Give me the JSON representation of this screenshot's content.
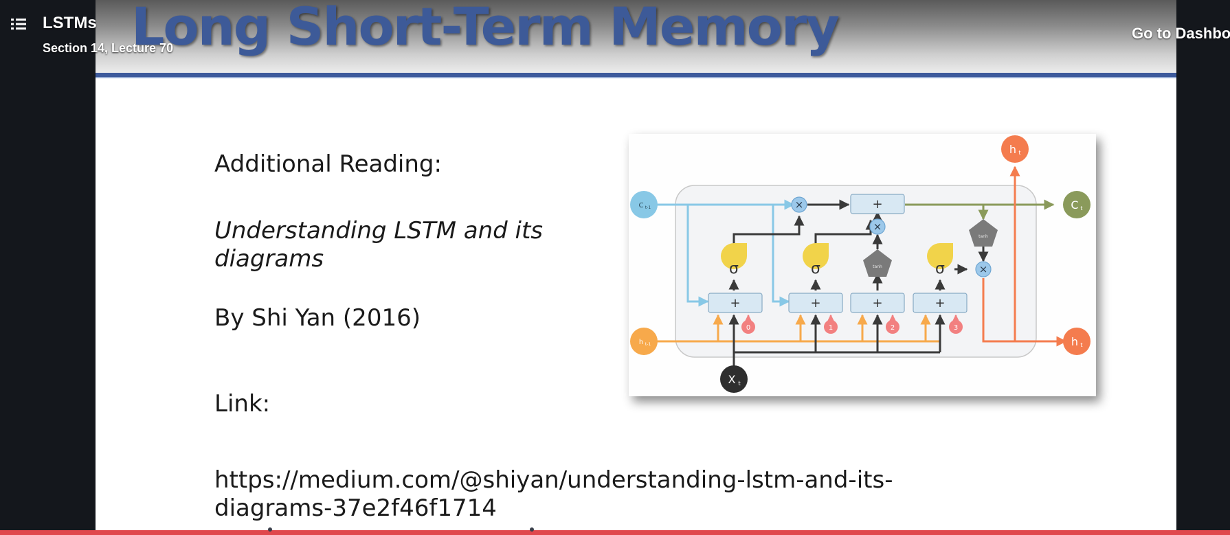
{
  "player": {
    "lecture_title": "LSTMs",
    "lecture_subtitle": "Section 14, Lecture 70",
    "dashboard_button": "Go to Dashbo"
  },
  "slide": {
    "title": "Long Short-Term Memory",
    "reading_heading": "Additional Reading:",
    "article_title_line1": "Understanding LSTM and its",
    "article_title_line2": "diagrams",
    "author": "By Shi Yan (2016)",
    "link_label": "Link:",
    "url_line1": "https://medium.com/@shiyan/understanding-lstm-and-its-",
    "url_line2": "diagrams-37e2f46f1714"
  },
  "diagram": {
    "inputs": {
      "c_prev": "C",
      "c_prev_sub": "t-1",
      "h_prev": "h",
      "h_prev_sub": "t-1",
      "x": "X",
      "x_sub": "t"
    },
    "outputs": {
      "h": "h",
      "h_sub": "t",
      "c": "C",
      "c_sub": "t"
    },
    "sigma": "σ",
    "plus": "+",
    "times": "×",
    "tanh": "tanh",
    "bias_labels": [
      "0",
      "1",
      "2",
      "3"
    ],
    "colors": {
      "cell": "#88c8e6",
      "hidden": "#f7a94b",
      "output": "#f47c4e",
      "cell_out": "#8a9a5b",
      "sigma": "#f1d34a",
      "tanh": "#7a7a7a",
      "bias": "#f28080",
      "box": "#d8e8f3"
    }
  },
  "progress": {
    "percent": 100
  }
}
